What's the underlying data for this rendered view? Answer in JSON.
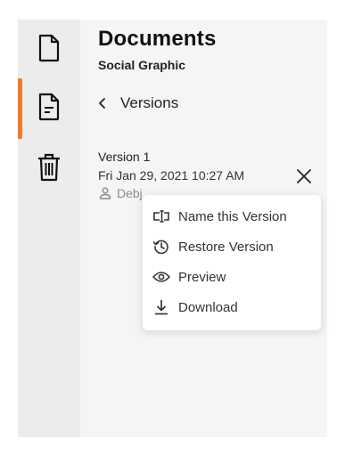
{
  "sidebar": {
    "items": [
      {
        "icon": "document-icon",
        "active": false
      },
      {
        "icon": "document-lines-icon",
        "active": true
      },
      {
        "icon": "trash-icon",
        "active": false
      }
    ],
    "accent_color": "#f07d2a"
  },
  "header": {
    "title": "Documents",
    "subtitle": "Social Graphic"
  },
  "nav": {
    "back_label": "Versions"
  },
  "version": {
    "name": "Version 1",
    "date": "Fri Jan 29, 2021 10:27 AM",
    "author": "Debj"
  },
  "menu": {
    "items": [
      {
        "label": "Name this Version",
        "icon": "rename-icon"
      },
      {
        "label": "Restore Version",
        "icon": "restore-history-icon"
      },
      {
        "label": "Preview",
        "icon": "eye-icon"
      },
      {
        "label": "Download",
        "icon": "download-icon"
      }
    ]
  }
}
